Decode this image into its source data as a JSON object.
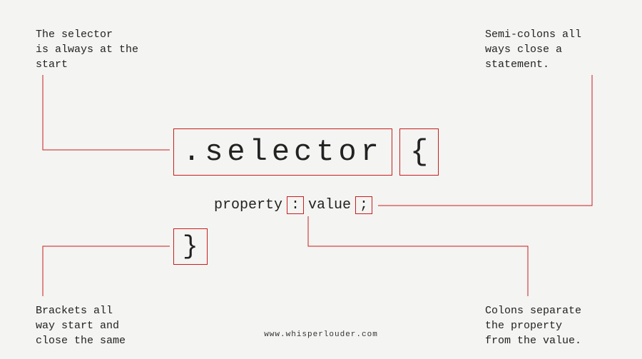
{
  "annotations": {
    "selector": "The selector\nis always at the\nstart",
    "semicolon": "Semi-colons all\nways close a\nstatement.",
    "brackets": "Brackets all\nway start and\nclose the same",
    "colon": "Colons separate\nthe property\nfrom the value."
  },
  "code": {
    "selector": ".selector",
    "brace_open": "{",
    "property": "property",
    "colon": ":",
    "value": "value",
    "semicolon": ";",
    "brace_close": "}"
  },
  "footer": "www.whisperlouder.com",
  "colors": {
    "line": "#c81e1e",
    "bg": "#f4f4f2"
  }
}
